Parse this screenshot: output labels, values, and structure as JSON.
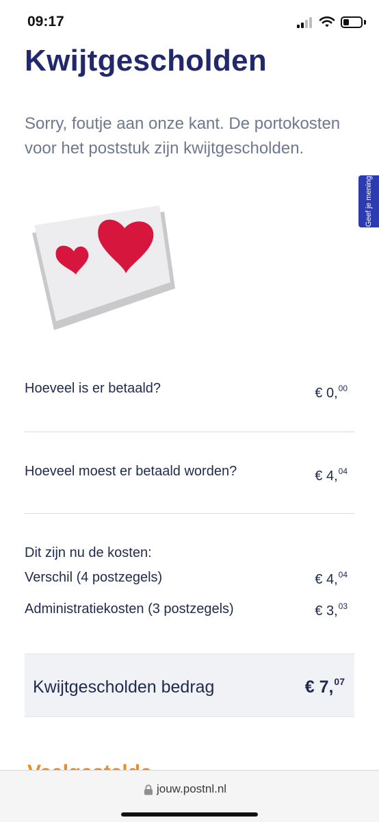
{
  "status": {
    "time": "09:17"
  },
  "page": {
    "title": "Kwijtgescholden",
    "intro": "Sorry, foutje aan onze kant. De portokosten voor het poststuk zijn kwijtgescholden."
  },
  "feedback": {
    "label": "Geef je mening"
  },
  "rows": [
    {
      "label": "Hoeveel is er betaald?",
      "currency": "€",
      "main": "0,",
      "cents": "00"
    },
    {
      "label": "Hoeveel moest er betaald worden?",
      "currency": "€",
      "main": "4,",
      "cents": "04"
    }
  ],
  "costs": {
    "heading": "Dit zijn nu de kosten:",
    "items": [
      {
        "label": "Verschil (4 postzegels)",
        "currency": "€",
        "main": "4,",
        "cents": "04"
      },
      {
        "label": "Administratiekosten (3 postzegels)",
        "currency": "€",
        "main": "3,",
        "cents": "03"
      }
    ]
  },
  "total": {
    "label": "Kwijtgescholden bedrag",
    "currency": "€",
    "main": "7,",
    "cents": "07"
  },
  "next_heading_peek": "Veelgestelde",
  "browser": {
    "url": "jouw.postnl.nl"
  },
  "colors": {
    "brand_blue": "#21286b",
    "feedback_blue": "#2d3bb0",
    "heart_red": "#d6163c",
    "orange": "#f08a24"
  }
}
